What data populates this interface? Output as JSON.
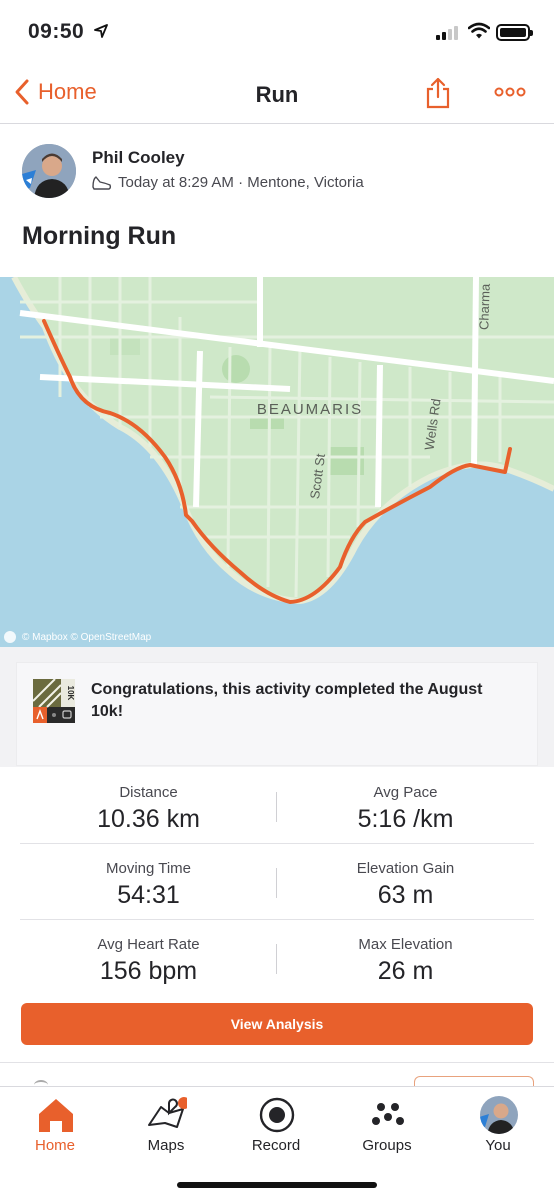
{
  "status_bar": {
    "time": "09:50"
  },
  "nav": {
    "back_label": "Home",
    "title": "Run"
  },
  "athlete": {
    "name": "Phil Cooley",
    "meta": "Today at 8:29 AM · Mentone, Victoria"
  },
  "activity": {
    "title": "Morning Run"
  },
  "map": {
    "suburb_label": "BEAUMARIS",
    "street_labels": [
      "Scott St",
      "Wells Rd",
      "Charma"
    ],
    "attribution": "© Mapbox © OpenStreetMap"
  },
  "challenge": {
    "badge_text": "10K",
    "message": "Congratulations, this activity completed the August 10k!"
  },
  "stats": [
    {
      "left": {
        "label": "Distance",
        "value": "10.36 km"
      },
      "right": {
        "label": "Avg Pace",
        "value": "5:16 /km"
      }
    },
    {
      "left": {
        "label": "Moving Time",
        "value": "54:31"
      },
      "right": {
        "label": "Elevation Gain",
        "value": "63 m"
      }
    },
    {
      "left": {
        "label": "Avg Heart Rate",
        "value": "156 bpm"
      },
      "right": {
        "label": "Max Elevation",
        "value": "26 m"
      }
    }
  ],
  "cta": {
    "label": "View Analysis"
  },
  "tabs": [
    {
      "label": "Home",
      "icon": "home-icon",
      "active": true
    },
    {
      "label": "Maps",
      "icon": "maps-icon"
    },
    {
      "label": "Record",
      "icon": "record-icon"
    },
    {
      "label": "Groups",
      "icon": "groups-icon"
    },
    {
      "label": "You",
      "icon": "avatar"
    }
  ],
  "colors": {
    "accent": "#e8602c",
    "water": "#aad4e6",
    "land": "#cfe8c9",
    "route": "#e8602c"
  }
}
